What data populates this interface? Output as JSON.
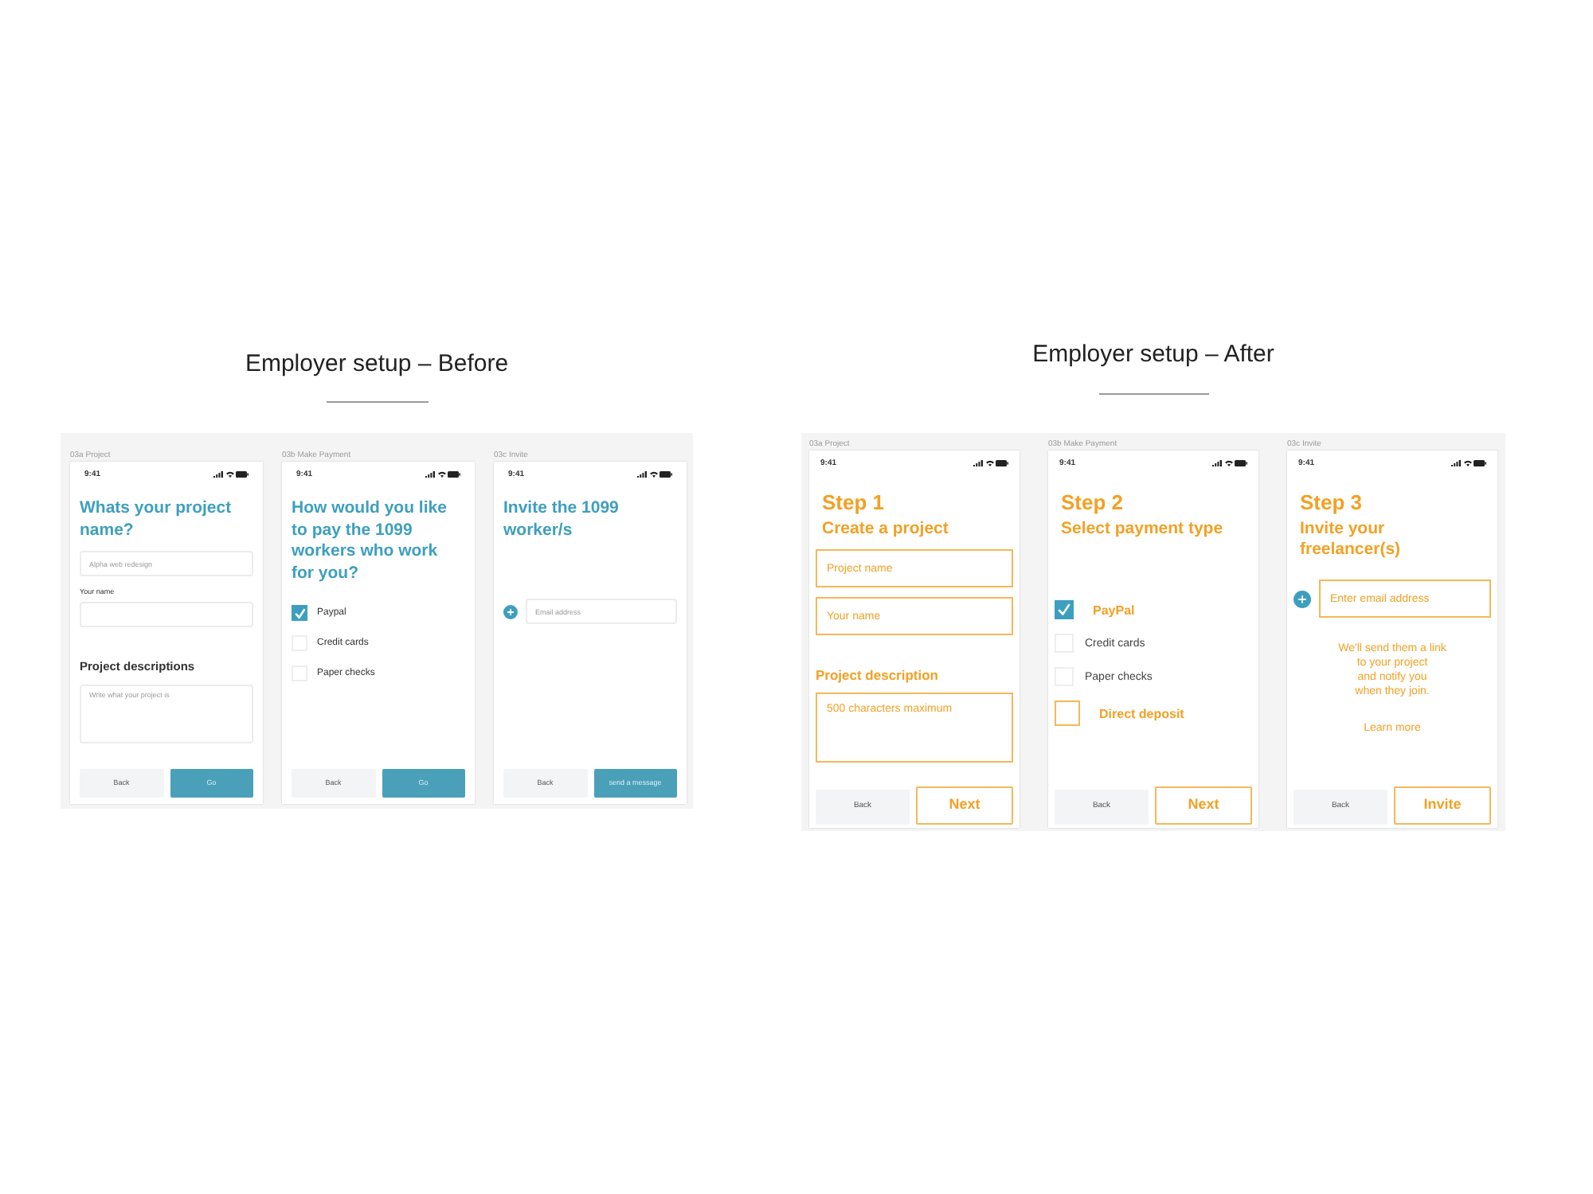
{
  "sections": [
    {
      "title": "Employer setup – Before",
      "screens": [
        {
          "frame_label": "03a Project",
          "time": "9:41",
          "heading": "Whats your project name?",
          "elements": [
            {
              "kind": "field",
              "placeholder": "Alpha web redesign"
            },
            {
              "kind": "label",
              "text": "Your name"
            },
            {
              "kind": "field"
            },
            {
              "kind": "section_label",
              "text": "Project descriptions"
            },
            {
              "kind": "textarea",
              "placeholder": "Write what your project is"
            }
          ],
          "buttons": [
            {
              "kind": "secondary",
              "label": "Back"
            },
            {
              "kind": "primary",
              "label": "Go"
            }
          ]
        },
        {
          "frame_label": "03b Make Payment",
          "time": "9:41",
          "heading": "How would you like to pay the 1099 workers who work for you?",
          "elements": [
            {
              "kind": "option",
              "label": "Paypal",
              "checked": true,
              "highlighted": false
            },
            {
              "kind": "option",
              "label": "Credit cards",
              "checked": false,
              "highlighted": false
            },
            {
              "kind": "option",
              "label": "Paper checks",
              "checked": false,
              "highlighted": false
            }
          ],
          "buttons": [
            {
              "kind": "secondary",
              "label": "Back"
            },
            {
              "kind": "primary",
              "label": "Go"
            }
          ]
        },
        {
          "frame_label": "03c Invite",
          "time": "9:41",
          "heading": "Invite the 1099 worker/s",
          "elements": [
            {
              "kind": "invite_field",
              "placeholder": "Email address"
            }
          ],
          "buttons": [
            {
              "kind": "secondary",
              "label": "Back"
            },
            {
              "kind": "primary",
              "label": "send a message"
            }
          ]
        }
      ]
    },
    {
      "title": "Employer setup – After",
      "screens": [
        {
          "frame_label": "03a Project",
          "time": "9:41",
          "step": "Step 1",
          "heading": "Create a project",
          "elements": [
            {
              "kind": "field",
              "placeholder": "Project name"
            },
            {
              "kind": "field",
              "placeholder": "Your name"
            },
            {
              "kind": "section_label",
              "text": "Project description"
            },
            {
              "kind": "textarea",
              "placeholder": "500 characters maximum"
            }
          ],
          "buttons": [
            {
              "kind": "secondary",
              "label": "Back"
            },
            {
              "kind": "primary",
              "label": "Next"
            }
          ]
        },
        {
          "frame_label": "03b Make Payment",
          "time": "9:41",
          "step": "Step 2",
          "heading": "Select payment type",
          "elements": [
            {
              "kind": "option",
              "label": "PayPal",
              "checked": true,
              "highlighted": true
            },
            {
              "kind": "option",
              "label": "Credit cards",
              "checked": false,
              "highlighted": false
            },
            {
              "kind": "option",
              "label": "Paper checks",
              "checked": false,
              "highlighted": false
            },
            {
              "kind": "option",
              "label": "Direct deposit",
              "checked": false,
              "highlighted": true
            }
          ],
          "buttons": [
            {
              "kind": "secondary",
              "label": "Back"
            },
            {
              "kind": "primary",
              "label": "Next"
            }
          ]
        },
        {
          "frame_label": "03c Invite",
          "time": "9:41",
          "step": "Step 3",
          "heading": "Invite your freelancer(s)",
          "elements": [
            {
              "kind": "invite_field",
              "placeholder": "Enter email address"
            },
            {
              "kind": "note",
              "text": "We'll send them a link\nto your project\nand notify you\nwhen they join."
            },
            {
              "kind": "link",
              "text": "Learn more"
            }
          ],
          "buttons": [
            {
              "kind": "secondary",
              "label": "Back"
            },
            {
              "kind": "primary",
              "label": "Invite"
            }
          ]
        }
      ]
    }
  ]
}
